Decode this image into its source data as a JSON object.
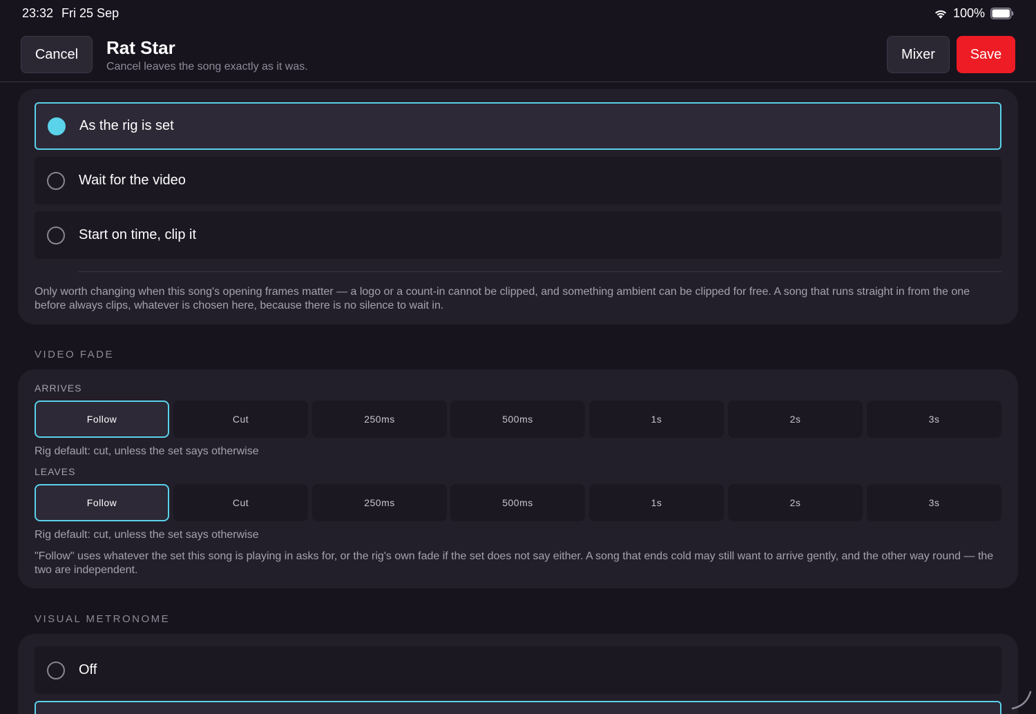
{
  "status_bar": {
    "time": "23:32",
    "date": "Fri 25 Sep",
    "battery": "100%"
  },
  "header": {
    "cancel_label": "Cancel",
    "title": "Rat Star",
    "subtitle": "Cancel leaves the song exactly as it was.",
    "mixer_label": "Mixer",
    "save_label": "Save"
  },
  "sync": {
    "options": [
      {
        "label": "As the rig is set",
        "selected": true
      },
      {
        "label": "Wait for the video",
        "selected": false
      },
      {
        "label": "Start on time, clip it",
        "selected": false
      }
    ],
    "note": "Only worth changing when this song's opening frames matter — a logo or a count-in cannot be clipped, and something ambient can be clipped for free. A song that runs straight in from the one before always clips, whatever is chosen here, because there is no silence to wait in."
  },
  "video_fade": {
    "section_label": "VIDEO FADE",
    "arrives": {
      "label": "ARRIVES",
      "options": [
        "Follow",
        "Cut",
        "250ms",
        "500ms",
        "1s",
        "2s",
        "3s"
      ],
      "selected": "Follow",
      "hint": "Rig default: cut, unless the set says otherwise"
    },
    "leaves": {
      "label": "LEAVES",
      "options": [
        "Follow",
        "Cut",
        "250ms",
        "500ms",
        "1s",
        "2s",
        "3s"
      ],
      "selected": "Follow",
      "hint": "Rig default: cut, unless the set says otherwise"
    },
    "note": "\"Follow\" uses whatever the set this song is playing in asks for, or the rig's own fade if the set does not say either. A song that ends cold may still want to arrive gently, and the other way round — the two are independent."
  },
  "visual_metronome": {
    "section_label": "VISUAL METRONOME",
    "options": [
      {
        "label": "Off",
        "selected": false
      }
    ]
  },
  "colors": {
    "background": "#17141e",
    "card": "#221f2a",
    "accent": "#5ad2ea",
    "save": "#ee1c24"
  }
}
